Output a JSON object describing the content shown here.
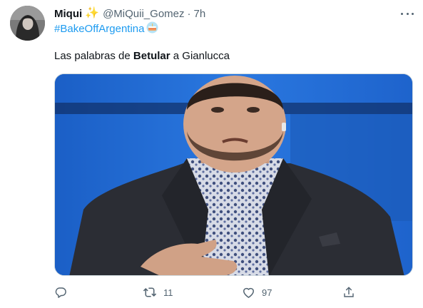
{
  "tweet": {
    "display_name": "Miqui",
    "name_emoji": "sparkles",
    "handle": "@MiQuii_Gomez",
    "separator": "·",
    "time": "7h",
    "hashtag": "#BakeOffArgentina",
    "hashtag_emoji": "birthday-cake",
    "text_prefix": "Las palabras de ",
    "text_bold": "Betular",
    "text_suffix": " a Gianlucca",
    "media": {
      "description": "studio photo placeholder: figure in dark suit with patterned shirt, hand on chest, blue background"
    },
    "actions": {
      "reply": {
        "icon": "reply-icon",
        "count": ""
      },
      "retweet": {
        "icon": "retweet-icon",
        "count": "11"
      },
      "like": {
        "icon": "heart-icon",
        "count": "97"
      },
      "share": {
        "icon": "share-icon",
        "count": ""
      }
    }
  },
  "colors": {
    "accent": "#1d9bf0",
    "muted_text": "#536471",
    "primary_text": "#0f1419",
    "background": "#ffffff"
  }
}
